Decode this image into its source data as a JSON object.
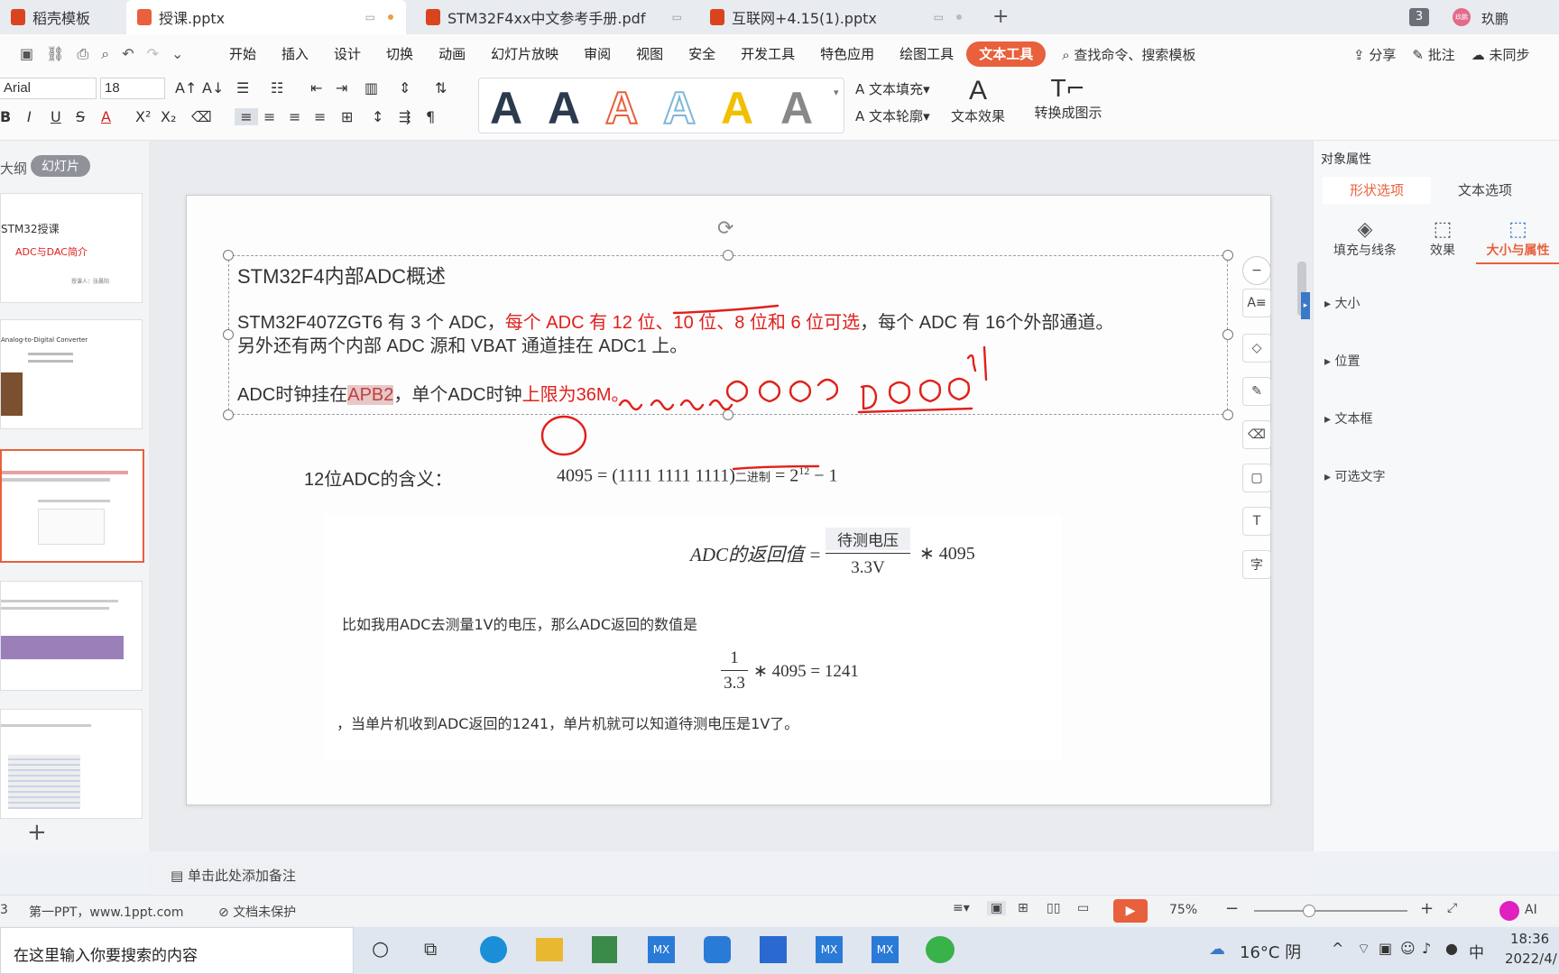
{
  "tabs": [
    {
      "label": "稻壳模板",
      "color": "#d9441f"
    },
    {
      "label": "授课.pptx",
      "color": "#e8603c"
    },
    {
      "label": "STM32F4xx中文参考手册.pdf",
      "color": "#d9441f"
    },
    {
      "label": "互联网+4.15(1).pptx",
      "color": "#d9441f"
    }
  ],
  "titlebar": {
    "count_badge": "3",
    "user_name": "玖鹏",
    "avatar_text": "玖鹏"
  },
  "menu": [
    "开始",
    "插入",
    "设计",
    "切换",
    "动画",
    "幻灯片放映",
    "审阅",
    "视图",
    "安全",
    "开发工具",
    "特色应用",
    "绘图工具",
    "文本工具"
  ],
  "menu_active": "文本工具",
  "search_command": "查找命令、搜索模板",
  "menu_right": {
    "share": "分享",
    "annotate": "批注",
    "sync": "未同步"
  },
  "ribbon": {
    "font_name": "Arial",
    "font_size": "18",
    "text_fill": "文本填充",
    "text_outline": "文本轮廓",
    "text_effect": "文本效果",
    "convert_smartart": "转换成图示",
    "style_colors": [
      "#2c3a4e",
      "#2c3a4e",
      "#e8603c",
      "#7fb8d8",
      "#f0c000",
      "#888888"
    ]
  },
  "leftpane": {
    "outline_tab": "大纲",
    "slides_tab": "幻灯片"
  },
  "thumbnails": {
    "t1_title": "STM32授课",
    "t1_subtitle": "ADC与DAC简介",
    "t1_author": "授课人：张晨阳",
    "t2_title": "Analog-to-Digital Converter"
  },
  "slide": {
    "heading": "STM32F4内部ADC概述",
    "para1_black1": "STM32F407ZGT6 有 3 个 ADC，",
    "para1_red": "每个 ADC 有 12 位、10 位、8 位和 6 位可选",
    "para1_black2": "，每个 ADC 有 16个外部通道。",
    "para1_line2": "另外还有两个内部 ADC 源和 VBAT 通道挂在 ADC1 上。",
    "para2_a": "ADC时钟挂在",
    "para2_hl": "APB2",
    "para2_b": "，单个ADC时钟",
    "para2_red": "上限为36M。",
    "meaning_label": "12位ADC的含义：",
    "formula_4095": "4095",
    "formula_eq": "= (1111 1111 1111)",
    "formula_sub": "二进制",
    "formula_eq2": "= 2",
    "formula_exp": "12",
    "formula_tail": " − 1",
    "adc_formula_lhs": "ADC的返回值 =",
    "adc_formula_num": "待测电压",
    "adc_formula_den": "3.3V",
    "adc_formula_mul": "∗ 4095",
    "example_text": "比如我用ADC去测量1V的电压，那么ADC返回的数值是",
    "calc_num": "1",
    "calc_den": "3.3",
    "calc_rest": "∗ 4095 = 1241",
    "conclusion": "，当单片机收到ADC返回的1241，单片机就可以知道待测电压是1V了。"
  },
  "rightpanel": {
    "title": "对象属性",
    "tab_shape": "形状选项",
    "tab_text": "文本选项",
    "opt_fill": "填充与线条",
    "opt_effect": "效果",
    "opt_size": "大小与属性",
    "sections": [
      "大小",
      "位置",
      "文本框",
      "可选文字"
    ]
  },
  "notes_placeholder": "单击此处添加备注",
  "status": {
    "slide_no": "3",
    "theme": "第一PPT，www.1ppt.com",
    "protect": "文档未保护",
    "zoom": "75%",
    "ai": "AI"
  },
  "taskbar": {
    "search": "在这里输入你要搜索的内容",
    "weather": "16°C 阴",
    "ime": "中",
    "time": "18:36",
    "date": "2022/4/"
  }
}
